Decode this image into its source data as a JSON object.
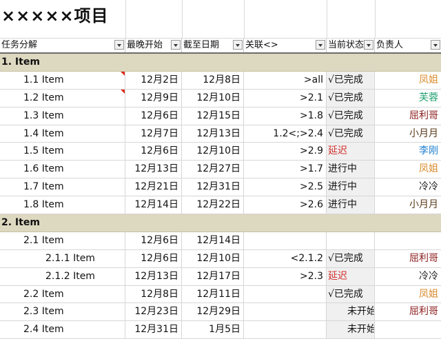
{
  "sheet": {
    "title": "×××××项目"
  },
  "headers": [
    "任务分解",
    "最晚开始",
    "截至日期",
    "关联<>",
    "当前状态",
    "负责人"
  ],
  "colors": {
    "section_bg": "#ddd8c0",
    "status_delayed": "#d0302c",
    "owner_fengjie": "#d98a2b",
    "owner_furong": "#20a070",
    "owner_qulige": "#8b1a1a",
    "owner_xiaoyueyue": "#5a3a1a",
    "owner_ligang": "#2080d0",
    "owner_lengleng": "#222222"
  },
  "rows": [
    {
      "type": "section",
      "label": "1. Item"
    },
    {
      "type": "task",
      "indent": 1,
      "task": "1.1 Item",
      "start": "12月2日",
      "due": "12月8日",
      "rel": ">all",
      "status": "√已完成",
      "owner": "凤姐",
      "owner_color": "#d98a2b",
      "flag": true
    },
    {
      "type": "task",
      "indent": 1,
      "task": "1.2 Item",
      "start": "12月9日",
      "due": "12月10日",
      "rel": ">2.1",
      "status": "√已完成",
      "owner": "芙蓉",
      "owner_color": "#20a070",
      "flag": true
    },
    {
      "type": "task",
      "indent": 1,
      "task": "1.3 Item",
      "start": "12月6日",
      "due": "12月15日",
      "rel": ">1.8",
      "status": "√已完成",
      "owner": "屈利哥",
      "owner_color": "#8b1a1a"
    },
    {
      "type": "task",
      "indent": 1,
      "task": "1.4 Item",
      "start": "12月7日",
      "due": "12月13日",
      "rel": "1.2<;>2.4",
      "status": "√已完成",
      "owner": "小月月",
      "owner_color": "#5a3a1a"
    },
    {
      "type": "task",
      "indent": 1,
      "task": "1.5 Item",
      "start": "12月6日",
      "due": "12月10日",
      "rel": ">2.9",
      "status": "延迟",
      "status_color": "#d0302c",
      "owner": "李刚",
      "owner_color": "#2080d0"
    },
    {
      "type": "task",
      "indent": 1,
      "task": "1.6 Item",
      "start": "12月13日",
      "due": "12月27日",
      "rel": ">1.7",
      "status": "进行中",
      "owner": "凤姐",
      "owner_color": "#d98a2b"
    },
    {
      "type": "task",
      "indent": 1,
      "task": "1.7 Item",
      "start": "12月21日",
      "due": "12月31日",
      "rel": ">2.5",
      "status": "进行中",
      "owner": "冷冷",
      "owner_color": "#222222"
    },
    {
      "type": "task",
      "indent": 1,
      "task": "1.8 Item",
      "start": "12月14日",
      "due": "12月22日",
      "rel": ">2.6",
      "status": "进行中",
      "owner": "小月月",
      "owner_color": "#5a3a1a"
    },
    {
      "type": "section",
      "label": "2. Item"
    },
    {
      "type": "task",
      "indent": 1,
      "task": "2.1 Item",
      "start": "12月6日",
      "due": "12月14日",
      "rel": "",
      "status": "",
      "owner": ""
    },
    {
      "type": "task",
      "indent": 2,
      "task": "2.1.1 Item",
      "start": "12月6日",
      "due": "12月10日",
      "rel": "<2.1.2",
      "status": "√已完成",
      "owner": "屈利哥",
      "owner_color": "#8b1a1a"
    },
    {
      "type": "task",
      "indent": 2,
      "task": "2.1.2 Item",
      "start": "12月13日",
      "due": "12月17日",
      "rel": ">2.3",
      "status": "延迟",
      "status_color": "#d0302c",
      "owner": "冷冷",
      "owner_color": "#222222"
    },
    {
      "type": "task",
      "indent": 1,
      "task": "2.2 Item",
      "start": "12月8日",
      "due": "12月11日",
      "rel": "",
      "status": "√已完成",
      "owner": "凤姐",
      "owner_color": "#d98a2b"
    },
    {
      "type": "task",
      "indent": 1,
      "task": "2.3 Item",
      "start": "12月23日",
      "due": "12月29日",
      "rel": "",
      "status": "　　未开始",
      "owner": "屈利哥",
      "owner_color": "#8b1a1a"
    },
    {
      "type": "task",
      "indent": 1,
      "task": "2.4 Item",
      "start": "12月31日",
      "due": "1月5日",
      "rel": "",
      "status": "　　未开始",
      "owner": ""
    }
  ]
}
